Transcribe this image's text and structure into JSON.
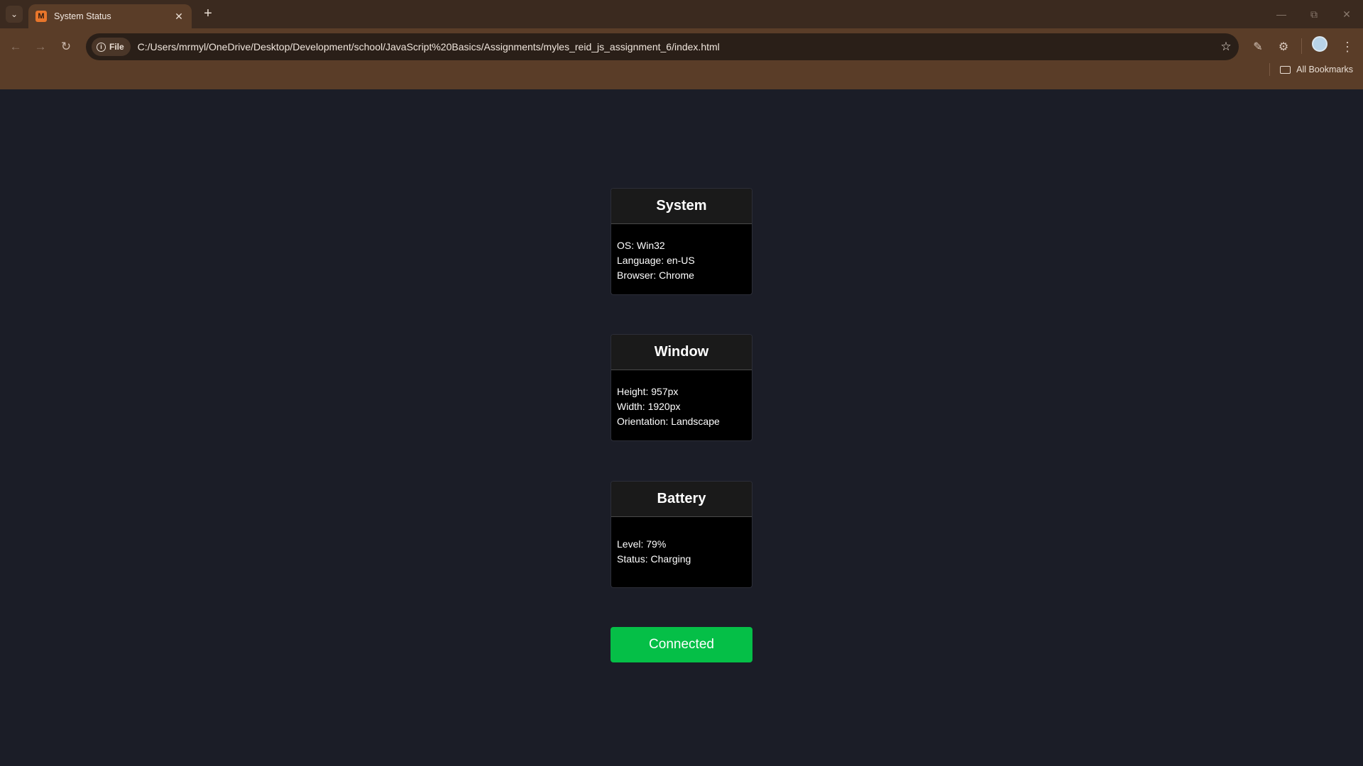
{
  "browser": {
    "tab_title": "System Status",
    "tab_favicon_letter": "M",
    "site_chip": "File",
    "url": "C:/Users/mrmyl/OneDrive/Desktop/Development/school/JavaScript%20Basics/Assignments/myles_reid_js_assignment_6/index.html",
    "bookmarks_label": "All Bookmarks",
    "theme_colors": {
      "tabstrip": "#3b2a1f",
      "toolbar": "#5a3d28",
      "omnibox": "#2a1f18"
    }
  },
  "page": {
    "background": "#1b1d27",
    "cards": [
      {
        "title": "System",
        "lines": [
          "OS: Win32",
          "Language: en-US",
          "Browser: Chrome"
        ]
      },
      {
        "title": "Window",
        "lines": [
          "Height: 957px",
          "Width: 1920px",
          "Orientation: Landscape"
        ]
      },
      {
        "title": "Battery",
        "lines": [
          "Level: 79%",
          "Status: Charging"
        ]
      }
    ],
    "status_button": {
      "label": "Connected",
      "color": "#05bf47"
    }
  }
}
